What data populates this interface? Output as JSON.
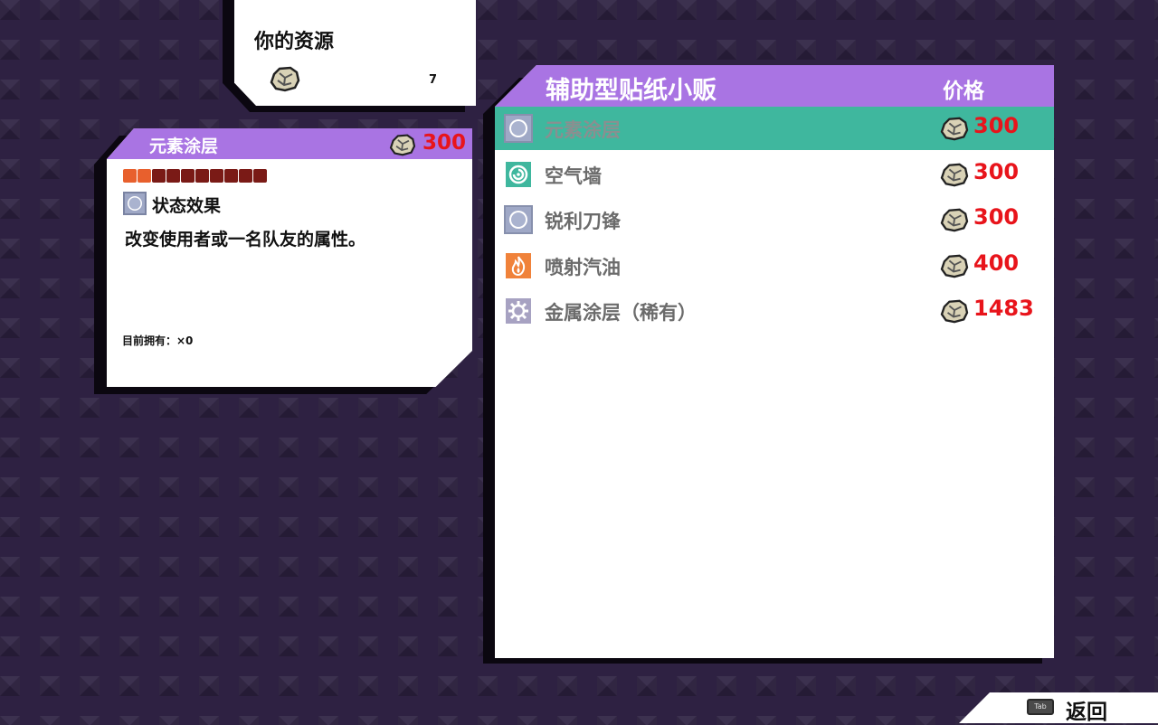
{
  "colors": {
    "accent_purple": "#a974e3",
    "selected_row": "#3fb79e",
    "price_red": "#e8141b",
    "bar_on": "#e8602d",
    "bar_off": "#7a1a16"
  },
  "resources": {
    "title": "你的资源",
    "icon": "rock-icon",
    "count": "7"
  },
  "detail": {
    "title": "元素涂层",
    "price": "300",
    "bar": {
      "filled": 2,
      "total": 10
    },
    "type_icon": "status-orb-icon",
    "type_label": "状态效果",
    "description": "改变使用者或一名队友的属性。",
    "owned": "目前拥有：×0"
  },
  "shop": {
    "title": "辅助型贴纸小贩",
    "price_header": "价格",
    "items": [
      {
        "name": "元素涂层",
        "price": "300",
        "icon": "status-orb-icon",
        "selected": true
      },
      {
        "name": "空气墙",
        "price": "300",
        "icon": "wind-swirl-icon",
        "selected": false
      },
      {
        "name": "锐利刀锋",
        "price": "300",
        "icon": "status-orb-icon",
        "selected": false
      },
      {
        "name": "喷射汽油",
        "price": "400",
        "icon": "fire-icon",
        "selected": false
      },
      {
        "name": "金属涂层（稀有）",
        "price": "1483",
        "icon": "gear-icon",
        "selected": false
      }
    ]
  },
  "footer": {
    "key_label": "Tab",
    "back_label": "返回"
  }
}
